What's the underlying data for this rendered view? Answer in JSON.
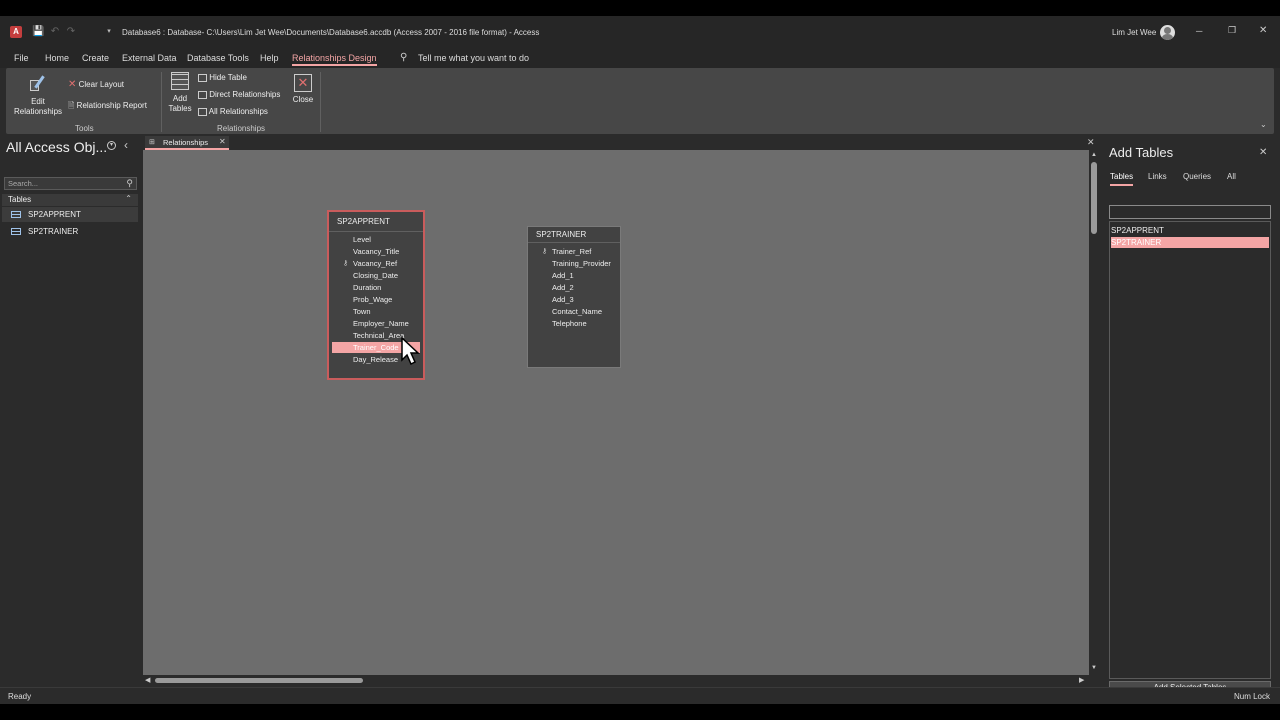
{
  "window": {
    "title": "Database6 : Database- C:\\Users\\Lim Jet Wee\\Documents\\Database6.accdb (Access 2007 - 2016 file format)  -  Access",
    "user": "Lim Jet Wee",
    "app_icon": "access-icon",
    "controls": {
      "minimize": "─",
      "restore": "❐",
      "close": "✕"
    }
  },
  "menu": {
    "items": [
      "File",
      "Home",
      "Create",
      "External Data",
      "Database Tools",
      "Help",
      "Relationships Design"
    ],
    "active": "Relationships Design",
    "search": "Tell me what you want to do"
  },
  "ribbon": {
    "edit_relationships": "Edit Relationships",
    "clear_layout": "Clear Layout",
    "relationship_report": "Relationship Report",
    "group_tools": "Tools",
    "add_tables": "Add Tables",
    "hide_table": "Hide Table",
    "direct_relationships": "Direct Relationships",
    "all_relationships": "All Relationships",
    "close": "Close",
    "group_relationships": "Relationships"
  },
  "nav": {
    "title": "All Access Obj...",
    "search_placeholder": "Search...",
    "section": "Tables",
    "items": [
      "SP2APPRENT",
      "SP2TRAINER"
    ]
  },
  "doc_tab": {
    "label": "Relationships"
  },
  "tables": [
    {
      "name": "SP2APPRENT",
      "fields": [
        "Level",
        "Vacancy_Title",
        "Vacancy_Ref",
        "Closing_Date",
        "Duration",
        "Prob_Wage",
        "Town",
        "Employer_Name",
        "Technical_Area",
        "Trainer_Code",
        "Day_Release"
      ],
      "key_field": "Vacancy_Ref",
      "selected_field": "Trainer_Code"
    },
    {
      "name": "SP2TRAINER",
      "fields": [
        "Trainer_Ref",
        "Training_Provider",
        "Add_1",
        "Add_2",
        "Add_3",
        "Contact_Name",
        "Telephone"
      ],
      "key_field": "Trainer_Ref"
    }
  ],
  "add_tables": {
    "title": "Add Tables",
    "tabs": [
      "Tables",
      "Links",
      "Queries",
      "All"
    ],
    "active_tab": "Tables",
    "list": [
      "SP2APPRENT",
      "SP2TRAINER"
    ],
    "selected": "SP2TRAINER",
    "button": "Add Selected Tables"
  },
  "status": {
    "left": "Ready",
    "right": "Num Lock"
  },
  "colors": {
    "accent": "#f4a5a5",
    "access_red": "#c43e3e",
    "highlight": "#f4a5a5"
  }
}
